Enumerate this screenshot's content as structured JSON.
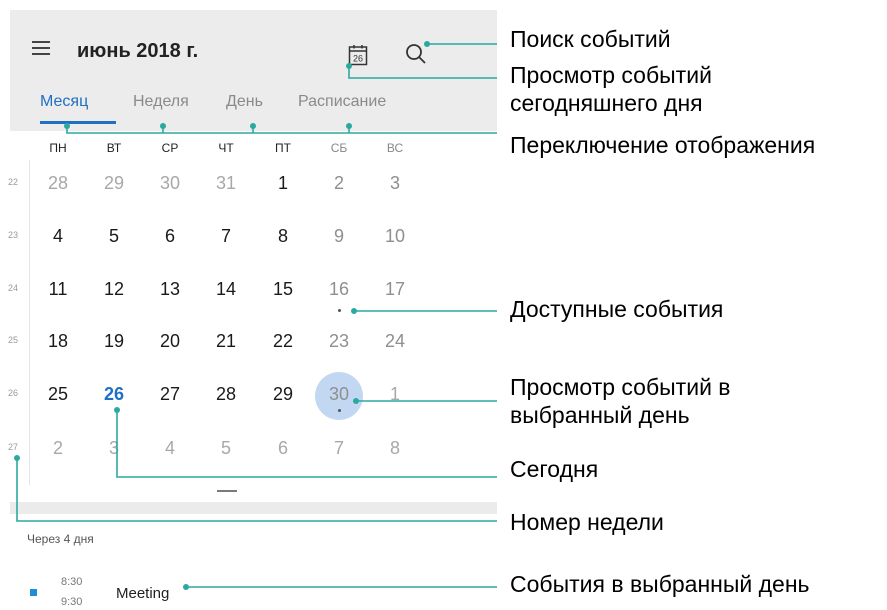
{
  "header": {
    "title": "июнь 2018 г.",
    "menu_icon": "menu-icon",
    "today_icon": "calendar-today-icon",
    "today_date": "26",
    "search_icon": "search-icon"
  },
  "tabs": [
    {
      "label": "Месяц",
      "active": true
    },
    {
      "label": "Неделя",
      "active": false
    },
    {
      "label": "День",
      "active": false
    },
    {
      "label": "Расписание",
      "active": false
    }
  ],
  "weekdays": [
    "ПН",
    "ВТ",
    "СР",
    "ЧТ",
    "ПТ",
    "СБ",
    "ВС"
  ],
  "weeks": [
    {
      "number": "22",
      "days": [
        "28",
        "29",
        "30",
        "31",
        "1",
        "2",
        "3"
      ]
    },
    {
      "number": "23",
      "days": [
        "4",
        "5",
        "6",
        "7",
        "8",
        "9",
        "10"
      ]
    },
    {
      "number": "24",
      "days": [
        "11",
        "12",
        "13",
        "14",
        "15",
        "16",
        "17"
      ]
    },
    {
      "number": "25",
      "days": [
        "18",
        "19",
        "20",
        "21",
        "22",
        "23",
        "24"
      ]
    },
    {
      "number": "26",
      "days": [
        "25",
        "26",
        "27",
        "28",
        "29",
        "30",
        "1"
      ]
    },
    {
      "number": "27",
      "days": [
        "2",
        "3",
        "4",
        "5",
        "6",
        "7",
        "8"
      ]
    }
  ],
  "today": "26",
  "selected_day": "30",
  "days_until": "Через 4 дня",
  "event": {
    "start": "8:30",
    "end": "9:30",
    "title": "Meeting",
    "color": "#1f8fd4"
  },
  "annotations": {
    "search": "Поиск событий",
    "today_view": [
      "Просмотр событий",
      "сегодняшнего дня"
    ],
    "switch_view": "Переключение отображения",
    "available": "Доступные события",
    "selected_view": [
      "Просмотр событий в",
      "выбранный день"
    ],
    "today": "Сегодня",
    "week_number": "Номер недели",
    "day_events": "События в выбранный день"
  },
  "colors": {
    "accent": "#1f6fc4",
    "leader_line": "#2aa9a0",
    "selection": "#c2d8f2"
  }
}
